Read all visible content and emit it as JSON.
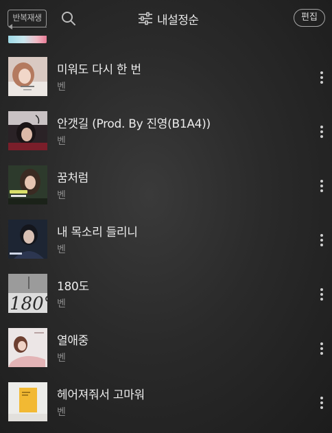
{
  "header": {
    "repeat_label": "반복재생",
    "sort_label": "내설정순",
    "edit_label": "편집"
  },
  "icons": {
    "search": "search-icon",
    "sort": "sliders-icon",
    "more": "vertical-dots-icon",
    "repeat": "repeat-icon"
  },
  "songs": [
    {
      "title": "미워도 다시 한 번",
      "artist": "벤"
    },
    {
      "title": "안갯길 (Prod. By 진영(B1A4))",
      "artist": "벤"
    },
    {
      "title": "꿈처럼",
      "artist": "벤"
    },
    {
      "title": "내 목소리 들리니",
      "artist": "벤"
    },
    {
      "title": "180도",
      "artist": "벤"
    },
    {
      "title": "열애중",
      "artist": "벤"
    },
    {
      "title": "헤어져줘서 고마워",
      "artist": "벤"
    }
  ],
  "album_art_text": {
    "song5": "180°"
  }
}
